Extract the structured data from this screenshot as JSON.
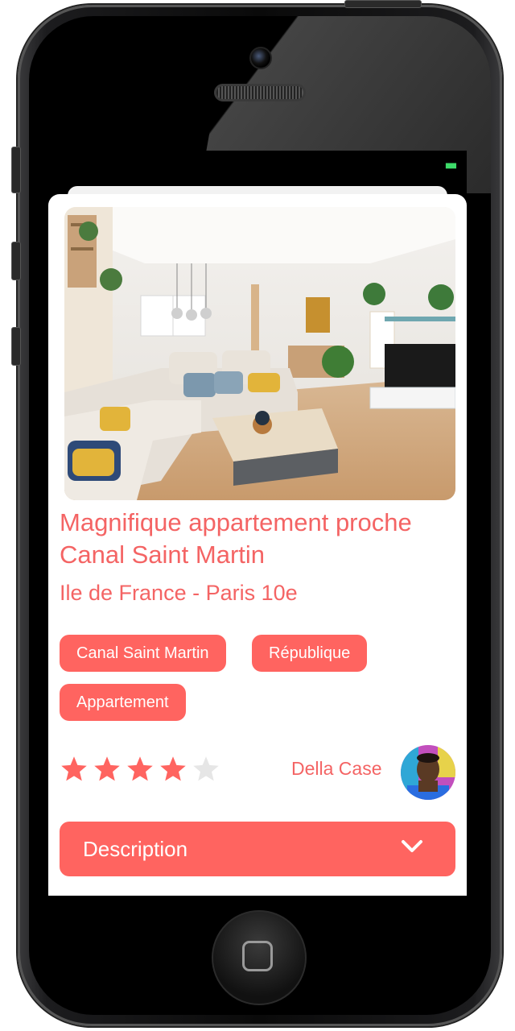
{
  "listing": {
    "title": "Magnifique appartement proche Canal Saint Martin",
    "location": "Ile de France - Paris 10e",
    "tags": [
      "Canal Saint Martin",
      "République",
      "Appartement"
    ],
    "rating": 4,
    "rating_max": 5,
    "host_name": "Della Case",
    "photo_icon": "living-room-photo",
    "avatar_icon": "host-avatar"
  },
  "description": {
    "label": "Description",
    "icon": "chevron-down-icon"
  },
  "colors": {
    "accent": "#ff6460",
    "text_accent": "#f46464",
    "star_empty": "#e6e6e6",
    "status_green": "#3ddc6a"
  }
}
